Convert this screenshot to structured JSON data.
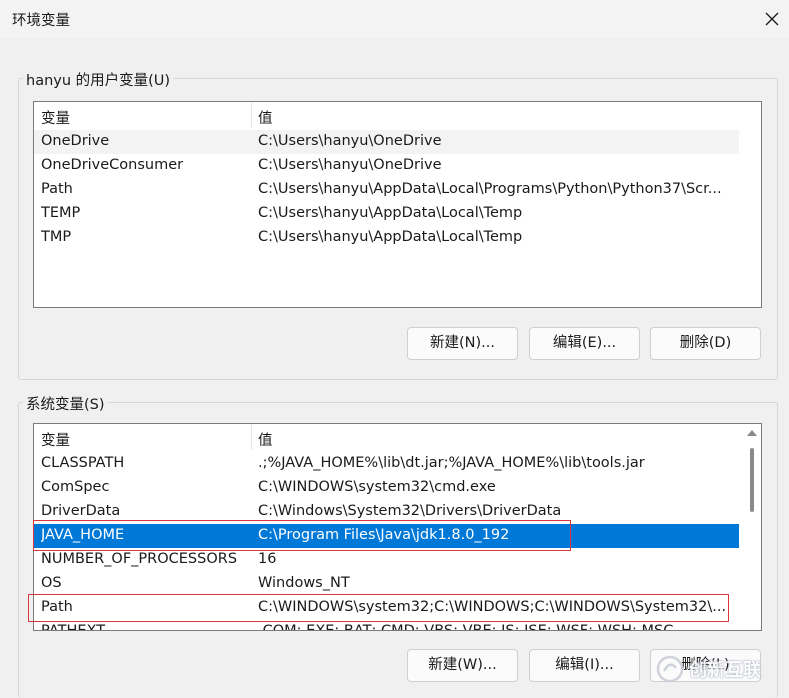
{
  "window": {
    "title": "环境变量"
  },
  "user_vars": {
    "group_label": "hanyu 的用户变量(U)",
    "columns": [
      "变量",
      "值"
    ],
    "rows": [
      {
        "name": "OneDrive",
        "value": "C:\\Users\\hanyu\\OneDrive"
      },
      {
        "name": "OneDriveConsumer",
        "value": "C:\\Users\\hanyu\\OneDrive"
      },
      {
        "name": "Path",
        "value": "C:\\Users\\hanyu\\AppData\\Local\\Programs\\Python\\Python37\\Scr..."
      },
      {
        "name": "TEMP",
        "value": "C:\\Users\\hanyu\\AppData\\Local\\Temp"
      },
      {
        "name": "TMP",
        "value": "C:\\Users\\hanyu\\AppData\\Local\\Temp"
      }
    ],
    "buttons": {
      "new": "新建(N)...",
      "edit": "编辑(E)...",
      "delete": "删除(D)"
    }
  },
  "system_vars": {
    "group_label": "系统变量(S)",
    "columns": [
      "变量",
      "值"
    ],
    "rows": [
      {
        "name": "CLASSPATH",
        "value": ".;%JAVA_HOME%\\lib\\dt.jar;%JAVA_HOME%\\lib\\tools.jar"
      },
      {
        "name": "ComSpec",
        "value": "C:\\WINDOWS\\system32\\cmd.exe"
      },
      {
        "name": "DriverData",
        "value": "C:\\Windows\\System32\\Drivers\\DriverData"
      },
      {
        "name": "JAVA_HOME",
        "value": "C:\\Program Files\\Java\\jdk1.8.0_192"
      },
      {
        "name": "NUMBER_OF_PROCESSORS",
        "value": "16"
      },
      {
        "name": "OS",
        "value": "Windows_NT"
      },
      {
        "name": "Path",
        "value": "C:\\WINDOWS\\system32;C:\\WINDOWS;C:\\WINDOWS\\System32\\..."
      },
      {
        "name": "PATHEXT",
        "value": ".COM;.EXE;.BAT;.CMD;.VBS;.VBE;.JS;.JSE;.WSF;.WSH;.MSC"
      }
    ],
    "selected_row": "JAVA_HOME",
    "buttons": {
      "new": "新建(W)...",
      "edit": "编辑(I)...",
      "delete": "删除(L)"
    }
  },
  "watermark": {
    "text": "创新互联"
  },
  "colors": {
    "selection": "#0078d7",
    "annotation": "#d9363e"
  },
  "icons": {
    "close": "close-icon",
    "scroll_up": "chevron-up-icon"
  }
}
